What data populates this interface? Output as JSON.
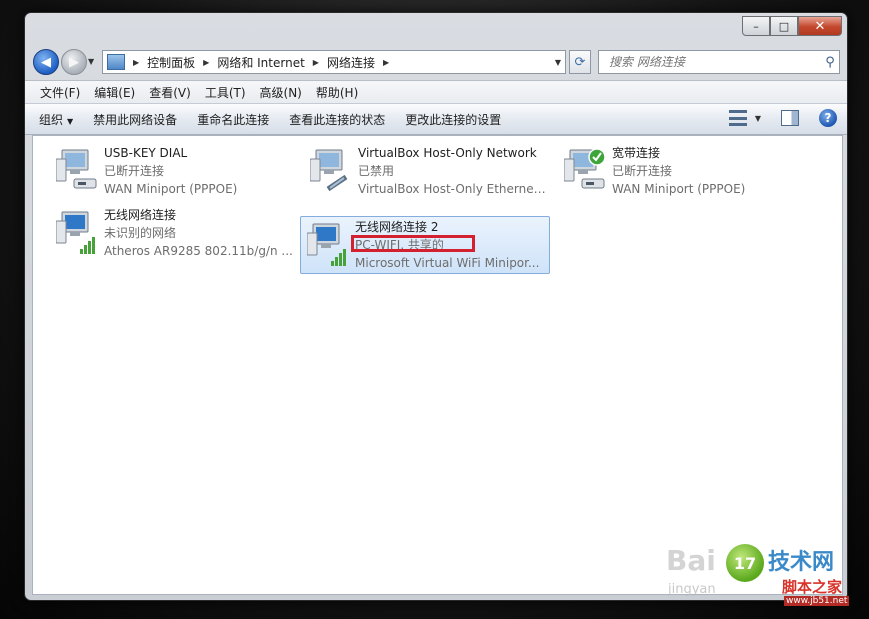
{
  "window": {
    "buttons": {
      "minimize": "–",
      "maximize": "□",
      "close": "✕"
    }
  },
  "address": {
    "crumbs": [
      "控制面板",
      "网络和 Internet",
      "网络连接"
    ],
    "search_placeholder": "搜索 网络连接"
  },
  "menu": [
    "文件(F)",
    "编辑(E)",
    "查看(V)",
    "工具(T)",
    "高级(N)",
    "帮助(H)"
  ],
  "commands": {
    "organize": "组织",
    "disable": "禁用此网络设备",
    "rename": "重命名此连接",
    "view_status": "查看此连接的状态",
    "change_settings": "更改此连接的设置"
  },
  "connections": [
    {
      "name": "USB-KEY DIAL",
      "status": "已断开连接",
      "device": "WAN Miniport (PPPOE)",
      "icon": "network-modem-icon"
    },
    {
      "name": "VirtualBox Host-Only Network",
      "status": "已禁用",
      "device": "VirtualBox Host-Only Ethernet ...",
      "icon": "network-ethernet-icon"
    },
    {
      "name": "宽带连接",
      "status": "已断开连接",
      "device": "WAN Miniport (PPPOE)",
      "icon": "network-modem-check-icon"
    },
    {
      "name": "无线网络连接",
      "status": "未识别的网络",
      "device": "Atheros AR9285 802.11b/g/n ...",
      "icon": "wireless-network-icon"
    },
    {
      "name": "无线网络连接 2",
      "status": "PC-WIFI, 共享的",
      "device": "Microsoft Virtual WiFi Minipor...",
      "icon": "wireless-network-icon",
      "selected": true
    }
  ],
  "watermark": {
    "baidu": "Bai",
    "domain": "jingyan",
    "logo": "17",
    "brand": "技术网",
    "sub": "脚本之家",
    "url": "www.jb51.net"
  },
  "colors": {
    "selection": "#cfe3f9",
    "highlight_box": "#d3212f",
    "status_text": "#6d6d6d"
  }
}
